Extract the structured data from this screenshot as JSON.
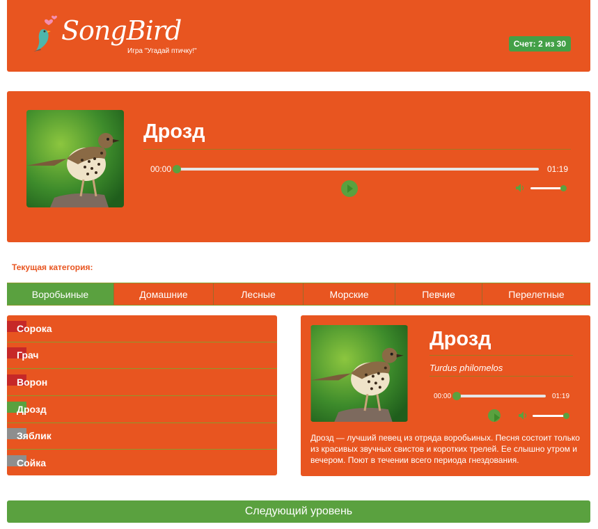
{
  "header": {
    "logo_text": "SongBird",
    "logo_subtitle": "Игра \"Угадай птичку!\"",
    "score": "Счет: 2 из 30"
  },
  "question": {
    "title": "Дрозд",
    "player": {
      "current_time": "00:00",
      "duration": "01:19",
      "progress": 0.0,
      "volume": 1.0
    }
  },
  "category_label": "Текущая категория:",
  "tabs": [
    {
      "label": "Воробьиные",
      "active": true
    },
    {
      "label": "Домашние",
      "active": false
    },
    {
      "label": "Лесные",
      "active": false
    },
    {
      "label": "Морские",
      "active": false
    },
    {
      "label": "Певчие",
      "active": false
    },
    {
      "label": "Перелетные",
      "active": false
    }
  ],
  "answers": [
    {
      "label": "Сорока",
      "status": "wrong"
    },
    {
      "label": "Грач",
      "status": "wrong"
    },
    {
      "label": "Ворон",
      "status": "wrong"
    },
    {
      "label": "Дрозд",
      "status": "correct"
    },
    {
      "label": "Зяблик",
      "status": "unchecked"
    },
    {
      "label": "Сойка",
      "status": "unchecked"
    }
  ],
  "info": {
    "title": "Дрозд",
    "latin": "Turdus philomelos",
    "player": {
      "current_time": "00:00",
      "duration": "01:19",
      "progress": 0.0,
      "volume": 1.0
    },
    "description": "Дрозд — лучший певец из отряда воробьиных. Песня состоит только из красивых звучных свистов и коротких трелей. Ее слышно утром и вечером. Поют в течении всего периода гнездования."
  },
  "next_button": "Следующий уровень",
  "colors": {
    "panel": "#e85520",
    "accent_green": "#5aa13f",
    "wrong": "#c62828",
    "correct": "#5aa13f",
    "unchecked": "#8e8e8e"
  }
}
